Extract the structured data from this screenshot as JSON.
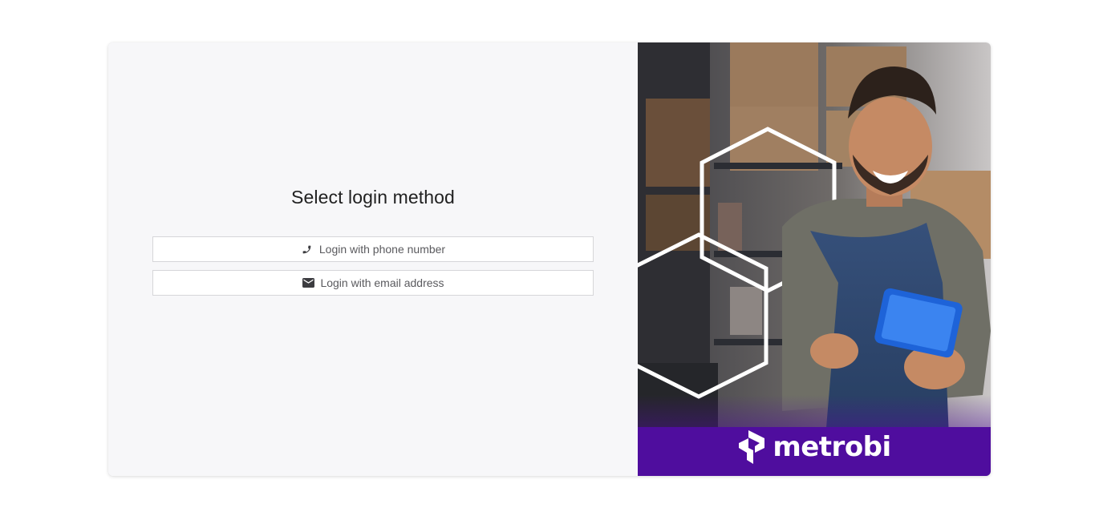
{
  "login": {
    "title": "Select login method",
    "phone_button_label": "Login with phone number",
    "email_button_label": "Login with email address"
  },
  "brand": {
    "name": "metrobi",
    "color": "#4f0d9e"
  },
  "icons": {
    "phone": "phone-icon",
    "email": "envelope-icon",
    "logo": "metrobi-logo-icon"
  },
  "illustration": {
    "description_name": "hero-image"
  }
}
